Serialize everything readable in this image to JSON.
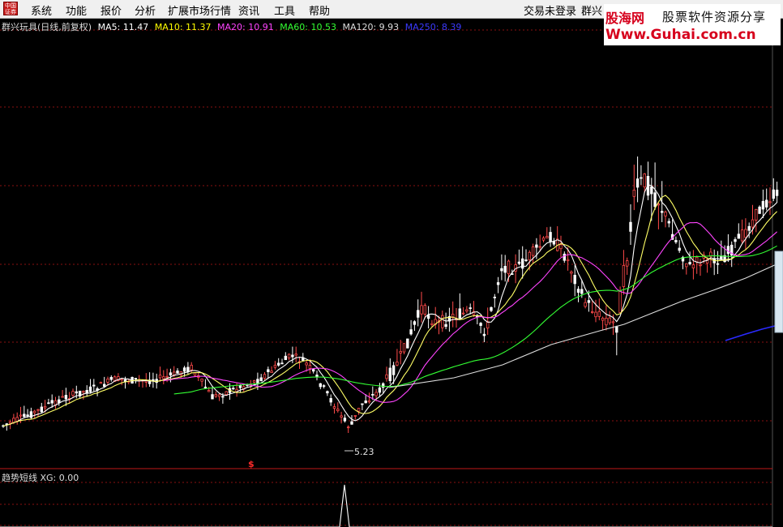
{
  "menubar": {
    "logo_line1": "中国",
    "logo_line2": "证券",
    "items": [
      "系统",
      "功能",
      "报价",
      "分析",
      "扩展市场行情",
      "资讯",
      "工具",
      "帮助"
    ],
    "right_items": [
      "交易未登录",
      "群兴"
    ]
  },
  "infoline": {
    "title": "群兴玩具(日线,前复权)",
    "ma": [
      {
        "label": "MA5: 11.47",
        "color": "#ffffff"
      },
      {
        "label": "MA10: 11.37",
        "color": "#ffff00"
      },
      {
        "label": "MA20: 10.91",
        "color": "#ff44ff"
      },
      {
        "label": "MA60: 10.53",
        "color": "#33ff33"
      },
      {
        "label": "MA120: 9.93",
        "color": "#dddddd"
      },
      {
        "label": "MA250: 8.39",
        "color": "#3a3aff"
      }
    ]
  },
  "ad": {
    "brand": "股海网",
    "slogan": "股票软件资源分享",
    "url": "Www.Guhai.com.cn"
  },
  "chart": {
    "low_label": "5.23",
    "signal_marker": "$"
  },
  "indicator": {
    "label": "趋势短线  XG: 0.00"
  },
  "colors": {
    "up_candle": "#ff4a4a",
    "down_candle": "#ffffff",
    "gridline": "#8a1010",
    "separator": "#c01818"
  }
}
